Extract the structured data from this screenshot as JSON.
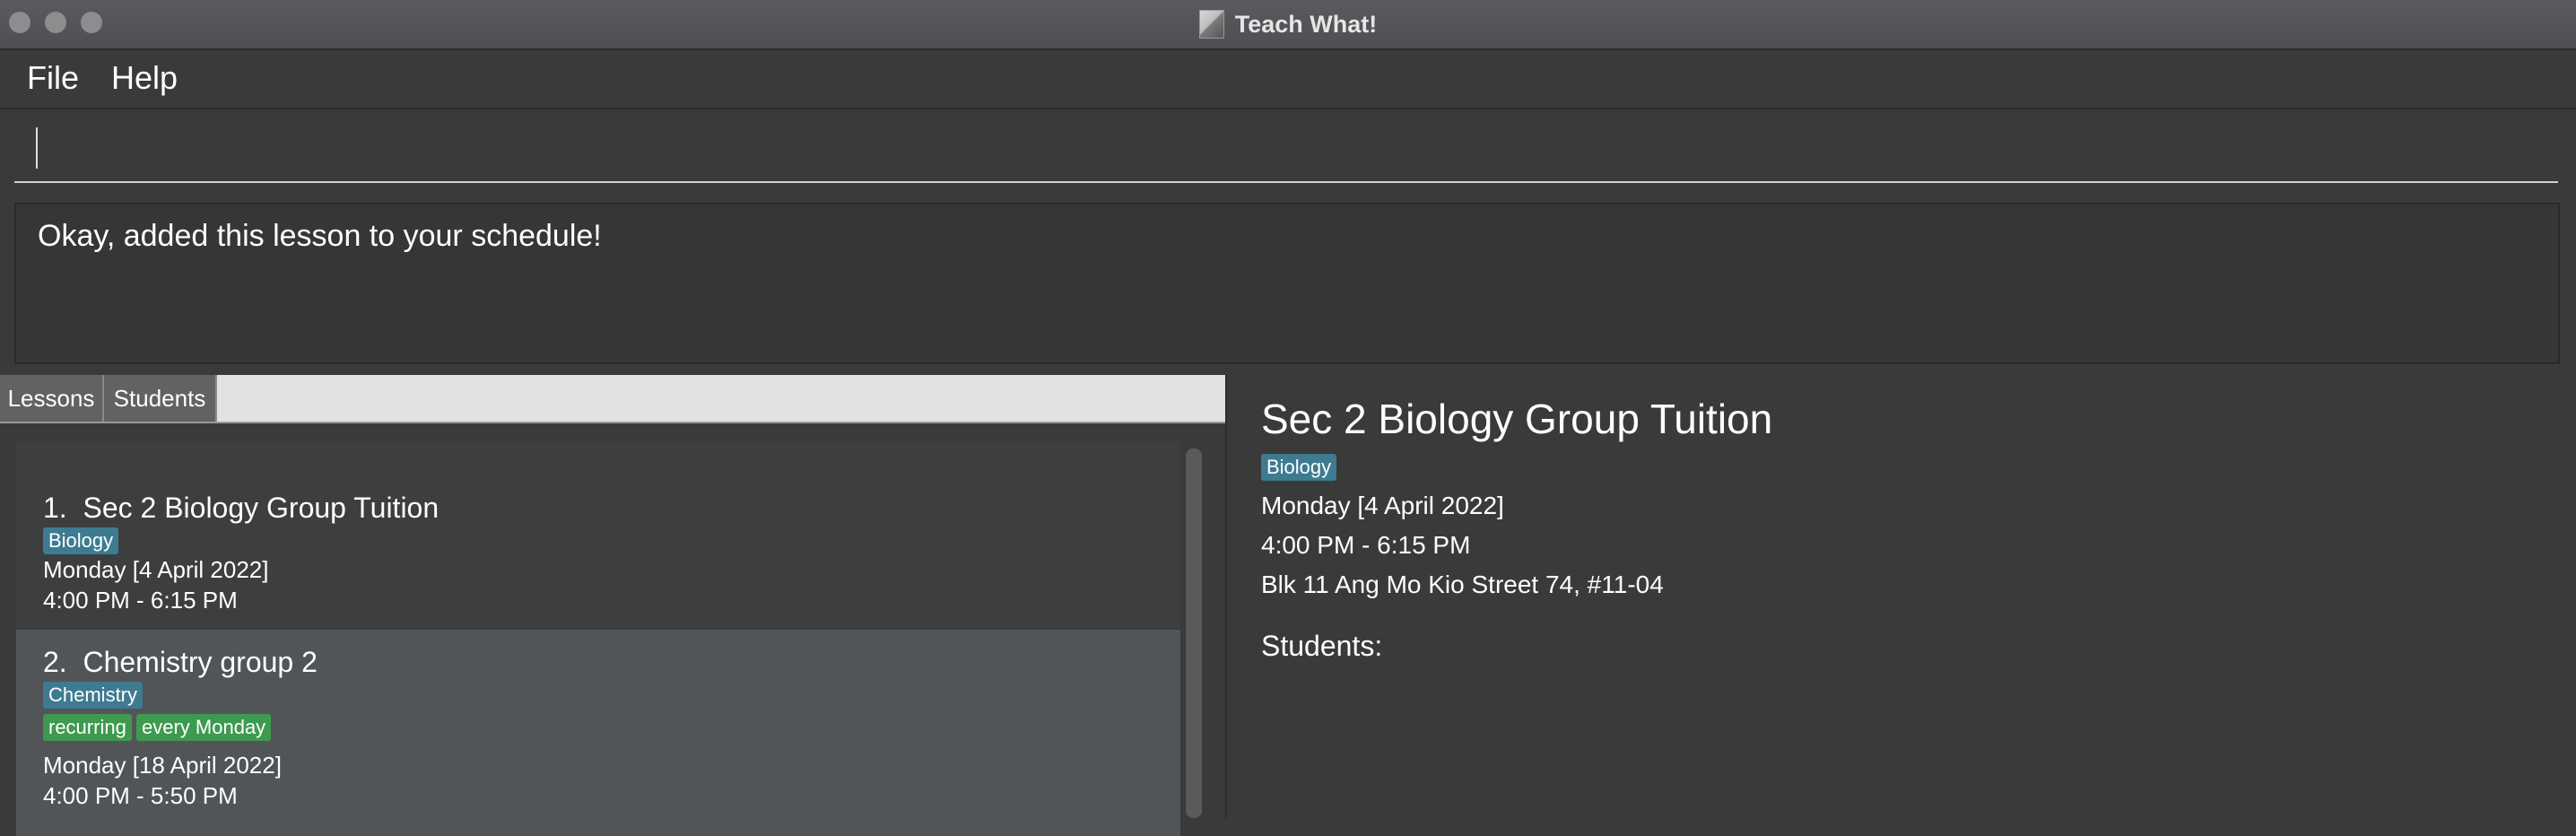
{
  "window": {
    "title": "Teach What!"
  },
  "menu": {
    "file": "File",
    "help": "Help"
  },
  "command_box": {
    "value": ""
  },
  "result": {
    "message": "Okay, added this lesson to your schedule!"
  },
  "tabs": [
    {
      "label": "Lessons"
    },
    {
      "label": "Students"
    }
  ],
  "lessons": [
    {
      "index": "1.",
      "name": "Sec 2 Biology Group Tuition",
      "subject": "Biology",
      "date": "Monday [4 April 2022]",
      "time": "4:00 PM - 6:15 PM"
    },
    {
      "index": "2.",
      "name": "Chemistry group 2",
      "subject": "Chemistry",
      "tags": [
        "recurring",
        "every Monday"
      ],
      "date": "Monday [18 April 2022]",
      "time": "4:00 PM - 5:50 PM"
    }
  ],
  "detail": {
    "name": "Sec 2 Biology Group Tuition",
    "subject": "Biology",
    "date": "Monday [4 April 2022]",
    "time": "4:00 PM - 6:15 PM",
    "address": "Blk 11 Ang Mo Kio Street 74, #11-04",
    "students_label": "Students:"
  },
  "colors": {
    "subject_tag": "#3e7b91",
    "recurring_tag": "#3e9a4f",
    "selected_row": "#515558"
  }
}
